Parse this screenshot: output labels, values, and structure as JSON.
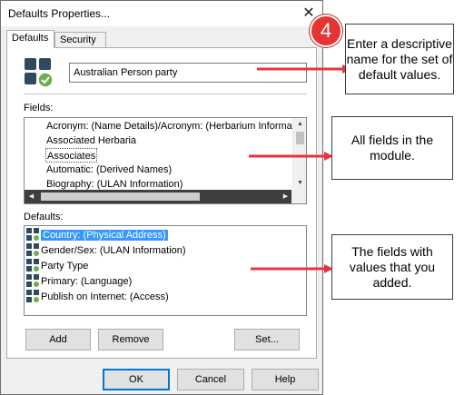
{
  "window": {
    "title": "Defaults Properties...",
    "close_glyph": "✕"
  },
  "tabs": [
    {
      "label": "Defaults",
      "active": true
    },
    {
      "label": "Security",
      "active": false
    }
  ],
  "name_field": {
    "value": "Australian Person party"
  },
  "fields": {
    "label": "Fields:",
    "items": [
      "Acronym: (Name Details)/Acronym: (Herbarium Informa",
      "Associated Herbaria",
      "Associates",
      "Automatic: (Derived Names)",
      "Biography: (ULAN Information)"
    ],
    "focused_index": 2
  },
  "defaults": {
    "label": "Defaults:",
    "items": [
      {
        "text": "Country: (Physical Address)",
        "selected": true
      },
      {
        "text": "Gender/Sex: (ULAN Information)",
        "selected": false
      },
      {
        "text": "Party Type",
        "selected": false
      },
      {
        "text": "Primary: (Language)",
        "selected": false
      },
      {
        "text": "Publish on Internet: (Access)",
        "selected": false
      }
    ]
  },
  "buttons": {
    "add": "Add",
    "remove": "Remove",
    "set": "Set...",
    "ok": "OK",
    "cancel": "Cancel",
    "help": "Help"
  },
  "annotations": {
    "step_number": "4",
    "callout_1": "Enter a descriptive name for the set of default values.",
    "callout_2": "All fields in the module.",
    "callout_3": "The fields with values that you added."
  },
  "colors": {
    "accent_blue": "#0078d7",
    "selection": "#3399ff",
    "arrow_red": "#e8353d",
    "icon_dark": "#2f4a5e",
    "icon_green": "#6ab04c"
  }
}
